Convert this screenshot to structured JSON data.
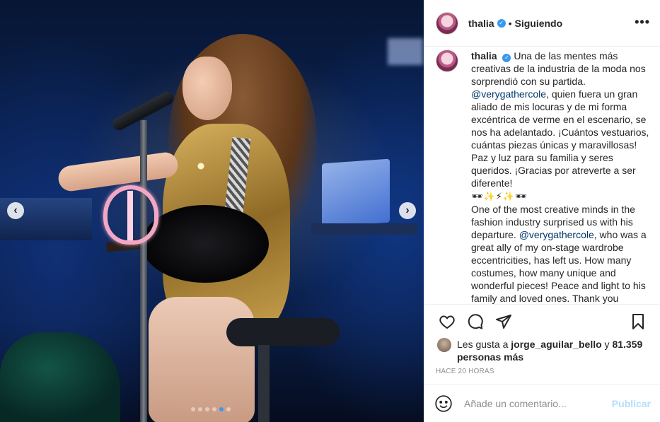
{
  "header": {
    "username": "thalia",
    "separator": "•",
    "follow_status": "Siguiendo",
    "more_label": "•••"
  },
  "media": {
    "prev_label": "‹",
    "next_label": "›",
    "carousel_count": 6,
    "carousel_active_index": 4
  },
  "caption": {
    "username": "thalia",
    "text_1": "Una de las mentes más creativas de la industria de la moda nos sorprendió con su partida.",
    "mention_1": "@verygathercole",
    "text_2": ", quien fuera un gran aliado de mis locuras y de mi forma excéntrica de verme en el escenario, se nos ha adelantado. ¡Cuántos vestuarios, cuántas piezas únicas y maravillosas! Paz y luz para su familia y seres queridos. ¡Gracias por atreverte a ser diferente!",
    "emojis": "🕶✨⚡✨🕶",
    "text_3": "One of the most creative minds in the fashion industry surprised us with his departure.",
    "mention_2": "@verygathercole",
    "text_4": ", who was a great ally of my on-stage wardrobe eccentricities, has left us. How many costumes, how many unique and wonderful pieces! Peace and light to his family and loved ones. Thank you"
  },
  "actions": {
    "like_icon": "heart-icon",
    "comment_icon": "comment-icon",
    "share_icon": "share-icon",
    "save_icon": "bookmark-icon"
  },
  "likes": {
    "prefix": "Les gusta a",
    "user": "jorge_aguilar_bello",
    "middle": "y",
    "count": "81.359 personas más"
  },
  "timestamp": "Hace 20 horas",
  "comment": {
    "placeholder": "Añade un comentario...",
    "publish_label": "Publicar"
  },
  "colors": {
    "accent": "#3897f0",
    "publish_disabled": "#b2dffc",
    "mention": "#00376b"
  }
}
